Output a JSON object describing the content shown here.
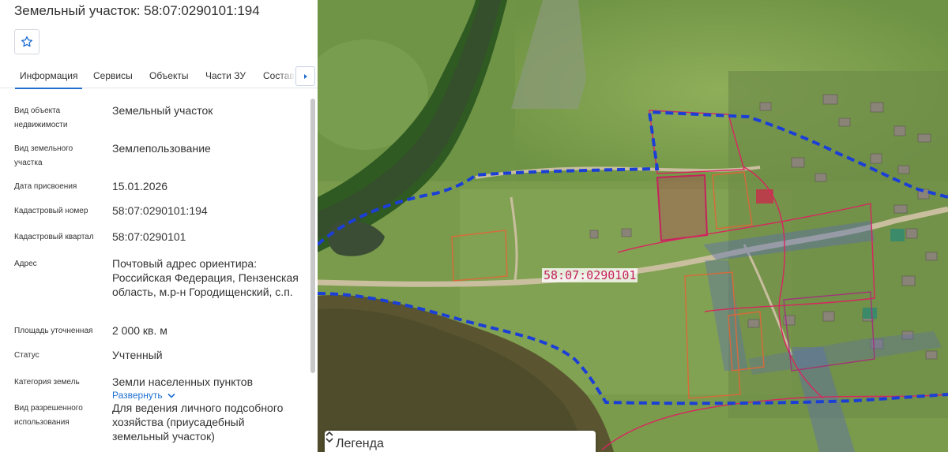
{
  "panel": {
    "title": "Земельный участок: 58:07:0290101:194",
    "tabs": [
      {
        "label": "Информация"
      },
      {
        "label": "Сервисы"
      },
      {
        "label": "Объекты"
      },
      {
        "label": "Части ЗУ"
      },
      {
        "label": "Состав"
      }
    ],
    "properties": [
      {
        "label": "Вид объекта недвижимости",
        "value": "Земельный участок"
      },
      {
        "label": "Вид земельного участка",
        "value": "Землепользование"
      },
      {
        "label": "Дата присвоения",
        "value": "15.01.2026"
      },
      {
        "label": "Кадастровый номер",
        "value": "58:07:0290101:194"
      },
      {
        "label": "Кадастровый квартал",
        "value": "58:07:0290101"
      },
      {
        "label": "Адрес",
        "value": "Почтовый адрес ориентира: Российская Федерация, Пензенская область, м.р-н Городищенский, с.п."
      },
      {
        "label": "Площадь уточненная",
        "value": "2 000 кв. м"
      },
      {
        "label": "Статус",
        "value": "Учтенный"
      },
      {
        "label": "Категория земель",
        "value": "Земли населенных пунктов"
      },
      {
        "label": "Вид разрешенного использования",
        "value": "Для ведения личного подсобного хозяйства (приусадебный земельный участок)"
      }
    ],
    "expand_label": "Развернуть"
  },
  "map": {
    "quarter_label": "58:07:0290101",
    "legend_title": "Легенда"
  },
  "icons": {
    "favorite": "star-outline-icon",
    "tabs_next": "chevron-right-icon",
    "expand": "chevron-down-icon",
    "legend_toggle": "chevron-up-down-icon"
  },
  "colors": {
    "accent": "#1f6fd1",
    "quarter_border": "#1b3fd6",
    "parcel_border": "#d8265f",
    "label_text": "#c4245c"
  }
}
